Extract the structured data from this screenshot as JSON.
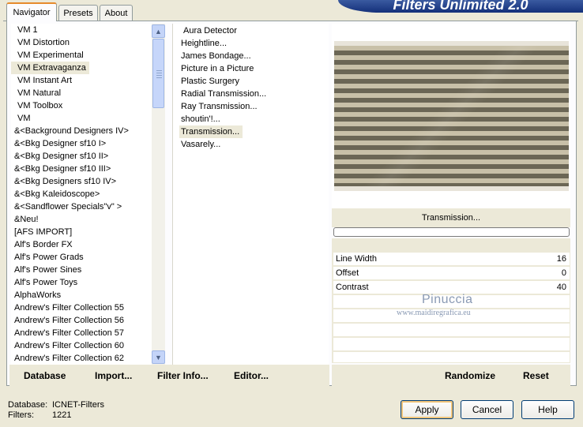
{
  "tabs": [
    {
      "label": "Navigator",
      "active": true
    },
    {
      "label": "Presets"
    },
    {
      "label": "About"
    }
  ],
  "banner_title": "Filters Unlimited 2.0",
  "categories": [
    "VM 1",
    "VM Distortion",
    "VM Experimental",
    "VM Extravaganza",
    "VM Instant Art",
    "VM Natural",
    "VM Toolbox",
    "VM",
    "&<Background Designers IV>",
    "&<Bkg Designer sf10 I>",
    "&<Bkg Designer sf10 II>",
    "&<Bkg Designer sf10 III>",
    "&<Bkg Designers sf10 IV>",
    "&<Bkg Kaleidoscope>",
    "&<Sandflower Specials\"v\" >",
    "&Neu!",
    "[AFS IMPORT]",
    "Alf's Border FX",
    "Alf's Power Grads",
    "Alf's Power Sines",
    "Alf's Power Toys",
    "AlphaWorks",
    "Andrew's Filter Collection 55",
    "Andrew's Filter Collection 56",
    "Andrew's Filter Collection 57",
    "Andrew's Filter Collection 60",
    "Andrew's Filter Collection 62"
  ],
  "selected_category": "VM Extravaganza",
  "filters": [
    "Aura Detector",
    "Heightline...",
    "James Bondage...",
    "Picture in a Picture",
    "Plastic Surgery",
    "Radial Transmission...",
    "Ray Transmission...",
    "shoutin'!...",
    "Transmission...",
    "Vasarely..."
  ],
  "selected_filter": "Transmission...",
  "preview": {
    "filter_name": "Transmission..."
  },
  "params": [
    {
      "label": "Line Width",
      "value": "16"
    },
    {
      "label": "Offset",
      "value": "0"
    },
    {
      "label": "Contrast",
      "value": "40"
    }
  ],
  "watermark": {
    "line1": "Pinuccia",
    "line2": "www.maidiregrafica.eu"
  },
  "bottom_links": {
    "database": "Database",
    "import": "Import...",
    "filter_info": "Filter Info...",
    "editor": "Editor...",
    "randomize": "Randomize",
    "reset": "Reset"
  },
  "status": {
    "database_label": "Database:",
    "database_value": "ICNET-Filters",
    "filters_label": "Filters:",
    "filters_value": "1221"
  },
  "buttons": {
    "apply": "Apply",
    "cancel": "Cancel",
    "help": "Help"
  },
  "colors": {
    "accent_tab": "#e68b2c",
    "banner": "#14307a",
    "panel_bg": "#ece9d8"
  }
}
